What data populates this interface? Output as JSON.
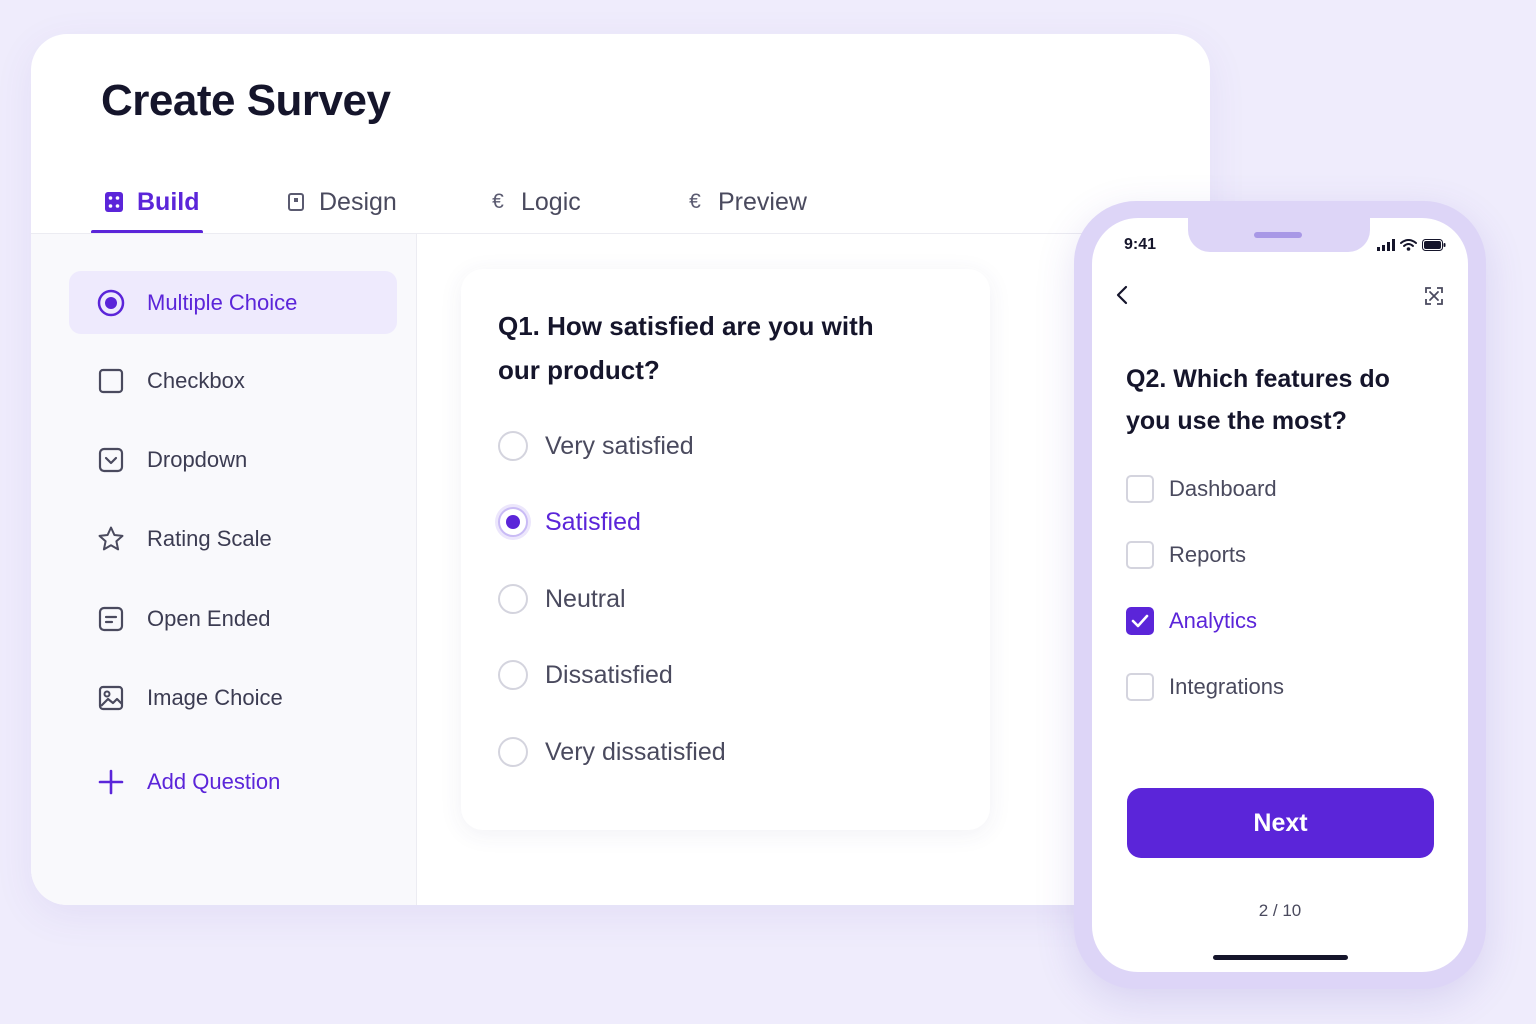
{
  "builder": {
    "title": "Create Survey",
    "tabs": [
      {
        "label": "Build",
        "icon": "build-icon",
        "active": true
      },
      {
        "label": "Design",
        "icon": "design-icon",
        "active": false
      },
      {
        "label": "Logic",
        "icon": "logic-icon",
        "active": false
      },
      {
        "label": "Preview",
        "icon": "preview-icon",
        "active": false
      }
    ],
    "question_types": [
      {
        "label": "Multiple Choice",
        "icon": "radio-icon",
        "active": true
      },
      {
        "label": "Checkbox",
        "icon": "checkbox-icon",
        "active": false
      },
      {
        "label": "Dropdown",
        "icon": "dropdown-icon",
        "active": false
      },
      {
        "label": "Rating Scale",
        "icon": "star-icon",
        "active": false
      },
      {
        "label": "Open Ended",
        "icon": "text-icon",
        "active": false
      },
      {
        "label": "Image Choice",
        "icon": "image-icon",
        "active": false
      }
    ],
    "add_question": "Add Question",
    "question": {
      "text": "Q1. How satisfied are you with our product?",
      "options": [
        {
          "label": "Very satisfied",
          "selected": false
        },
        {
          "label": "Satisfied",
          "selected": true
        },
        {
          "label": "Neutral",
          "selected": false
        },
        {
          "label": "Dissatisfied",
          "selected": false
        },
        {
          "label": "Very dissatisfied",
          "selected": false
        }
      ]
    }
  },
  "phone": {
    "status_time": "9:41",
    "question": "Q2. Which features do you use the most?",
    "options": [
      {
        "label": "Dashboard",
        "checked": false
      },
      {
        "label": "Reports",
        "checked": false
      },
      {
        "label": "Analytics",
        "checked": true
      },
      {
        "label": "Integrations",
        "checked": false
      }
    ],
    "next_label": "Next",
    "progress": "2 / 10"
  },
  "colors": {
    "accent": "#5b25d9",
    "background": "#efecfc",
    "text": "#15152b"
  }
}
